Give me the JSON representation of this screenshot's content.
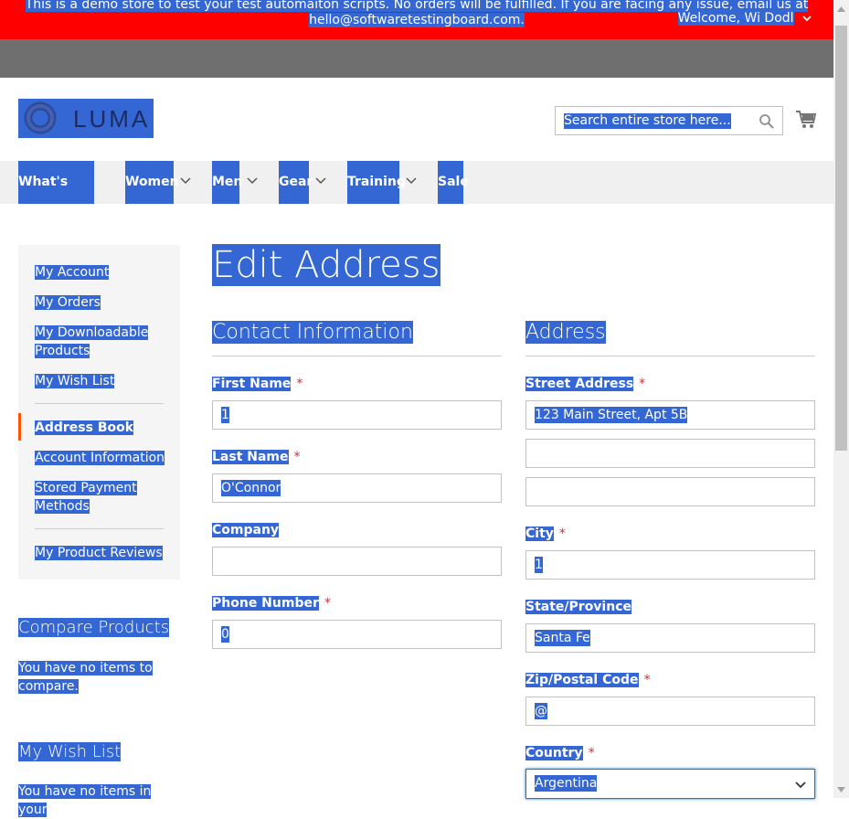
{
  "banner": {
    "line1": "This is a demo store to test your test automaiton scripts. No orders will be fulfilled. If you are facing any issue, email us at",
    "line2": "hello@softwaretestingboard.com."
  },
  "header": {
    "welcome": "Welcome, Wi Dodl",
    "logo_text": "LUMA",
    "search_placeholder": "Search entire store here..."
  },
  "nav": {
    "items": [
      "What's New",
      "Women",
      "Men",
      "Gear",
      "Training",
      "Sale"
    ]
  },
  "sidebar": {
    "links": [
      "My Account",
      "My Orders",
      "My Downloadable Products",
      "My Wish List",
      "Address Book",
      "Account Information",
      "Stored Payment Methods",
      "My Product Reviews"
    ],
    "active": "Address Book",
    "compare_title": "Compare Products",
    "compare_text": "You have no items to compare.",
    "wishlist_title": "My Wish List",
    "wishlist_text": "You have no items in your"
  },
  "page": {
    "title": "Edit Address",
    "contact_title": "Contact Information",
    "address_title": "Address"
  },
  "form": {
    "first_name": {
      "label": "First Name",
      "value": "1",
      "required": "*"
    },
    "last_name": {
      "label": "Last Name",
      "value": "O'Connor",
      "required": "*"
    },
    "company": {
      "label": "Company",
      "value": ""
    },
    "phone": {
      "label": "Phone Number",
      "value": "0",
      "required": "*"
    },
    "street": {
      "label": "Street Address",
      "value1": "123 Main Street, Apt 5B",
      "value2": "",
      "value3": "",
      "required": "*"
    },
    "city": {
      "label": "City",
      "value": "1",
      "required": "*"
    },
    "state": {
      "label": "State/Province",
      "value": "Santa Fe"
    },
    "zip": {
      "label": "Zip/Postal Code",
      "value": "@",
      "required": "*"
    },
    "country": {
      "label": "Country",
      "value": "Argentina",
      "required": "*"
    }
  },
  "colors": {
    "banner": "#fe0000",
    "selection": "#3466d4",
    "required": "#e02b27",
    "active_marker": "#ff5501"
  }
}
